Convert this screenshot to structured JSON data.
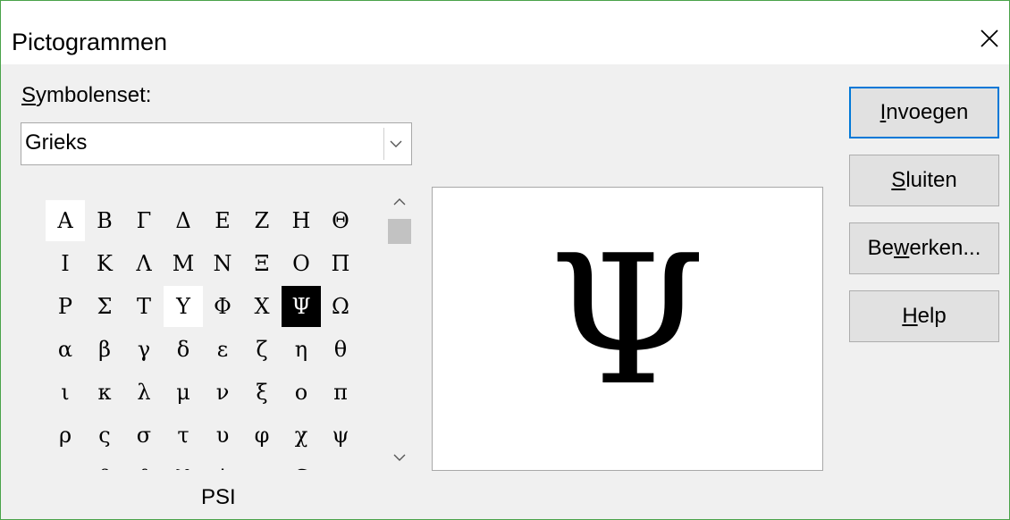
{
  "dialog": {
    "title": "Pictogrammen"
  },
  "symbolset": {
    "label_mn": "S",
    "label_rest": "ymbolenset:",
    "value": "Grieks"
  },
  "grid": {
    "rows": [
      [
        "Α",
        "Β",
        "Γ",
        "Δ",
        "Ε",
        "Ζ",
        "Η",
        "Θ"
      ],
      [
        "Ι",
        "Κ",
        "Λ",
        "Μ",
        "Ν",
        "Ξ",
        "Ο",
        "Π"
      ],
      [
        "Ρ",
        "Σ",
        "Τ",
        "Υ",
        "Φ",
        "Χ",
        "Ψ",
        "Ω"
      ],
      [
        "α",
        "β",
        "γ",
        "δ",
        "ε",
        "ζ",
        "η",
        "θ"
      ],
      [
        "ι",
        "κ",
        "λ",
        "μ",
        "ν",
        "ξ",
        "ο",
        "π"
      ],
      [
        "ρ",
        "ς",
        "σ",
        "τ",
        "υ",
        "φ",
        "χ",
        "ψ"
      ],
      [
        "ω",
        "ϐ",
        "ϑ",
        "ϒ",
        "ϕ",
        "ϖ",
        "Ϛ",
        "ϛ"
      ]
    ],
    "selected": "Ψ",
    "highlighted": [
      "Α",
      "Υ"
    ]
  },
  "char_name": "PSI",
  "preview": {
    "glyph": "Ψ"
  },
  "buttons": {
    "insert": {
      "mn": "I",
      "rest": "nvoegen"
    },
    "close": {
      "mn": "S",
      "rest": "luiten"
    },
    "edit": {
      "pre": "Be",
      "mn": "w",
      "rest": "erken..."
    },
    "help": {
      "mn": "H",
      "rest": "elp"
    }
  }
}
